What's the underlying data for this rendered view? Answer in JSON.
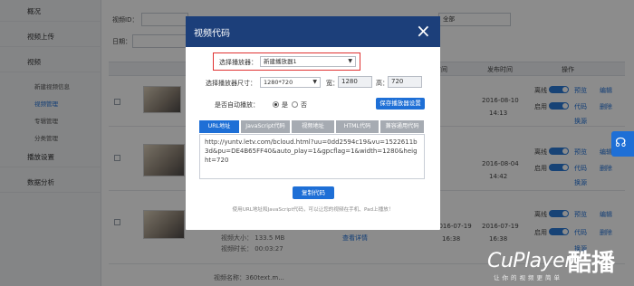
{
  "sidebar": {
    "items": [
      {
        "label": "概况"
      },
      {
        "label": "视频上传"
      },
      {
        "label": "视频"
      },
      {
        "label": "播放设置"
      },
      {
        "label": "数据分析"
      }
    ],
    "subitems": [
      {
        "label": "新建视频信息"
      },
      {
        "label": "视频管理"
      },
      {
        "label": "专辑管理"
      },
      {
        "label": "分类管理"
      }
    ]
  },
  "filters": {
    "video_id_label": "视频ID：",
    "date_label": "日期：",
    "status_value": "全部"
  },
  "table": {
    "headers": [
      "时间",
      "发布时间",
      "操作"
    ],
    "rows": [
      {
        "upload": "2016-08-10",
        "publish": "2016-08-10",
        "time": "14:13",
        "status_a": "离线",
        "status_b": "启用",
        "act1": "预览",
        "act2": "编辑",
        "act3": "代码",
        "act4": "删除",
        "act5": "换源"
      },
      {
        "upload": "2016-08-04",
        "publish": "2016-08-04",
        "time": "14:42",
        "status_a": "离线",
        "status_b": "启用",
        "act1": "预览",
        "act2": "编辑",
        "act3": "代码",
        "act4": "删除",
        "act5": "换源"
      },
      {
        "upload": "2016-07-19",
        "publish": "2016-07-19",
        "time": "16:38",
        "status_a": "离线",
        "status_b": "启用",
        "act1": "预览",
        "act2": "编辑",
        "act3": "代码",
        "act4": "删除",
        "act5": "换源"
      }
    ],
    "detail_link": "查看详情",
    "size_label": "视频大小：",
    "size_value": "133.5 MB",
    "duration_label": "视频时长：",
    "duration_value": "00:03:27",
    "name_label": "视频名称：",
    "name_value": "360text.m..."
  },
  "modal": {
    "title": "视频代码",
    "close": "×",
    "player_label": "选择播放器：",
    "player_value": "新建播放器1",
    "size_label": "选择播放器尺寸：",
    "size_value": "1280*720",
    "width_label": "宽：",
    "width_value": "1280",
    "height_label": "高：",
    "height_value": "720",
    "autoplay_label": "是否自动播放：",
    "yes": "是",
    "no": "否",
    "save_button": "保存播放器设置",
    "tabs": [
      "URL地址",
      "JavaScript代码",
      "视频地址",
      "HTML代码",
      "兼容通用代码"
    ],
    "active_tab": 0,
    "code": "http://yuntv.letv.com/bcloud.html?uu=0dd2594c19&vu=1522611b3d&pu=DE4B65FF40&auto_play=1&gpcflag=1&width=1280&height=720",
    "copy_button": "复制代码",
    "hint": "使用URL地址和JavaScript代码，可以让您的视频在手机、Pad上播放！"
  },
  "watermark": {
    "brand": "CuPlayer",
    "brand_cn": "酷播",
    "tagline": "让你的视频更简单"
  },
  "colors": {
    "modal_header": "#1c3f7a",
    "accent": "#1e6fd6",
    "highlight": "#e03232"
  }
}
